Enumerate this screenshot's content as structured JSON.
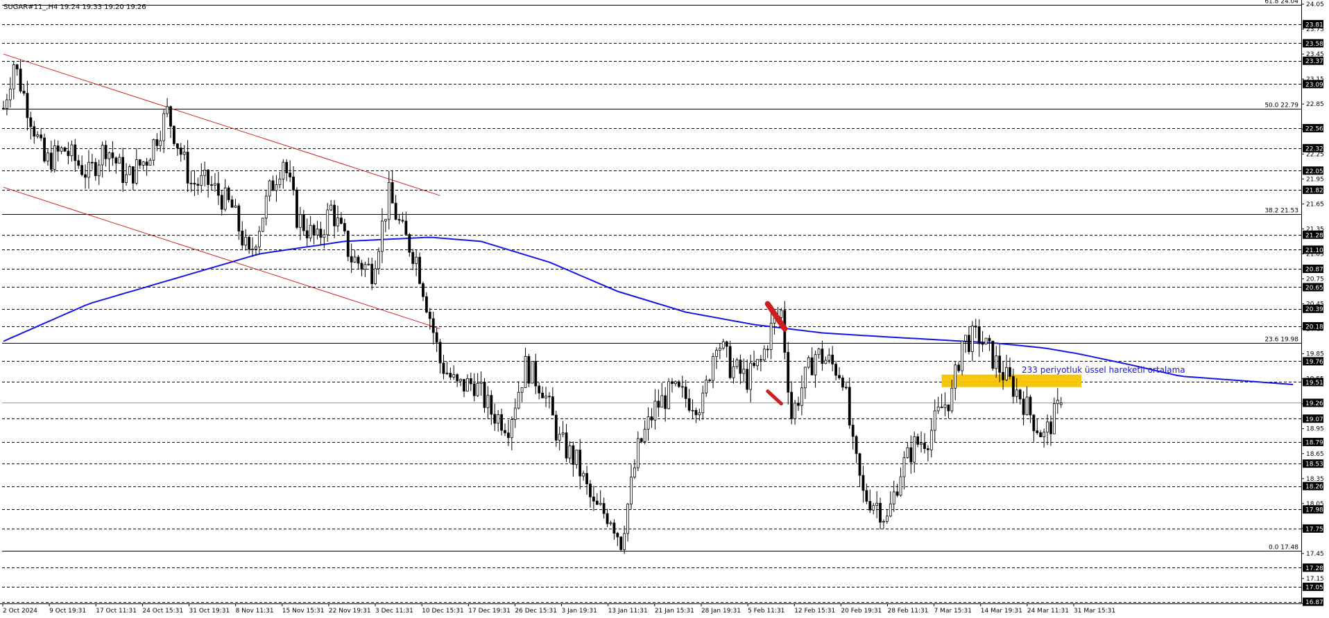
{
  "header": {
    "symbol_text": "SUGAR#11_,H4  19.24 19.33 19.20 19.26"
  },
  "colors": {
    "background": "#ffffff",
    "grid": "#000000",
    "candle_body": "#000000",
    "ema": "#1515e6",
    "channel": "#cc2222",
    "highlight": "#f5c400",
    "ema_label": "#1515e6",
    "marker": "#cc1f1f",
    "price_box_bg": "#000000",
    "price_box_fg": "#ffffff"
  },
  "chart_data": {
    "type": "candlestick",
    "symbol": "SUGAR#11",
    "timeframe": "H4",
    "last_bar": {
      "open": 19.24,
      "high": 19.33,
      "low": 19.2,
      "close": 19.26
    },
    "ylim": [
      16.87,
      24.04
    ],
    "x_tick_labels": [
      "2 Oct 2024",
      "9 Oct 19:31",
      "17 Oct 11:31",
      "24 Oct 15:31",
      "31 Oct 19:31",
      "8 Nov 11:31",
      "15 Nov 15:31",
      "22 Nov 19:31",
      "3 Dec 11:31",
      "10 Dec 15:31",
      "17 Dec 19:31",
      "26 Dec 15:31",
      "3 Jan 19:31",
      "13 Jan 11:31",
      "21 Jan 15:31",
      "28 Jan 19:31",
      "5 Feb 11:31",
      "12 Feb 15:31",
      "20 Feb 19:31",
      "28 Feb 11:31",
      "7 Mar 15:31",
      "14 Mar 19:31",
      "24 Mar 11:31",
      "31 Mar 15:31"
    ],
    "y_tick_labels": [
      {
        "value": 24.05,
        "text": "24.05"
      },
      {
        "value": 23.75,
        "text": "23.75"
      },
      {
        "value": 23.45,
        "text": "23.45"
      },
      {
        "value": 23.15,
        "text": "23.15"
      },
      {
        "value": 22.85,
        "text": "22.85"
      },
      {
        "value": 22.55,
        "text": "22.55"
      },
      {
        "value": 22.25,
        "text": "22.25"
      },
      {
        "value": 21.95,
        "text": "21.95"
      },
      {
        "value": 21.65,
        "text": "21.65"
      },
      {
        "value": 21.35,
        "text": "21.35"
      },
      {
        "value": 21.05,
        "text": "21.05"
      },
      {
        "value": 20.75,
        "text": "20.75"
      },
      {
        "value": 20.45,
        "text": "20.45"
      },
      {
        "value": 20.15,
        "text": "20.15"
      },
      {
        "value": 19.85,
        "text": "19.85"
      },
      {
        "value": 19.55,
        "text": "19.55"
      },
      {
        "value": 19.25,
        "text": "19.25"
      },
      {
        "value": 18.95,
        "text": "18.95"
      },
      {
        "value": 18.65,
        "text": "18.65"
      },
      {
        "value": 18.35,
        "text": "18.35"
      },
      {
        "value": 18.05,
        "text": "18.05"
      },
      {
        "value": 17.75,
        "text": "17.75"
      },
      {
        "value": 17.45,
        "text": "17.45"
      },
      {
        "value": 17.15,
        "text": "17.15"
      },
      {
        "value": 16.85,
        "text": "16.85"
      }
    ],
    "horizontal_levels": [
      {
        "value": 23.81,
        "text": "23.81"
      },
      {
        "value": 23.58,
        "text": "23.58"
      },
      {
        "value": 23.37,
        "text": "23.37"
      },
      {
        "value": 23.09,
        "text": "23.09"
      },
      {
        "value": 22.56,
        "text": "22.56"
      },
      {
        "value": 22.32,
        "text": "22.32"
      },
      {
        "value": 22.05,
        "text": "22.05"
      },
      {
        "value": 21.82,
        "text": "21.82"
      },
      {
        "value": 21.28,
        "text": "21.28"
      },
      {
        "value": 21.1,
        "text": "21.10"
      },
      {
        "value": 20.87,
        "text": "20.87"
      },
      {
        "value": 20.65,
        "text": "20.65"
      },
      {
        "value": 20.39,
        "text": "20.39"
      },
      {
        "value": 20.18,
        "text": "20.18"
      },
      {
        "value": 19.76,
        "text": "19.76"
      },
      {
        "value": 19.51,
        "text": "19.51"
      },
      {
        "value": 19.07,
        "text": "19.07"
      },
      {
        "value": 18.79,
        "text": "18.79"
      },
      {
        "value": 18.53,
        "text": "18.53"
      },
      {
        "value": 18.26,
        "text": "18.26"
      },
      {
        "value": 17.98,
        "text": "17.98"
      },
      {
        "value": 17.75,
        "text": "17.75"
      },
      {
        "value": 17.28,
        "text": "17.28"
      },
      {
        "value": 17.05,
        "text": "17.05"
      },
      {
        "value": 16.87,
        "text": "16.87"
      }
    ],
    "fibonacci_levels": [
      {
        "value": 24.04,
        "text": "61.8 24.04"
      },
      {
        "value": 22.79,
        "text": "50.0 22.79"
      },
      {
        "value": 21.53,
        "text": "38.2 21.53"
      },
      {
        "value": 19.98,
        "text": "23.6 19.98"
      },
      {
        "value": 17.48,
        "text": "0.0 17.48"
      }
    ],
    "current_price": {
      "value": 19.26,
      "text": "19.26"
    },
    "annotation": "233 periyotluk üssel hareketli ortalama",
    "ema_anchors": [
      [
        0,
        20.0
      ],
      [
        25,
        20.45
      ],
      [
        50,
        20.75
      ],
      [
        75,
        21.05
      ],
      [
        100,
        21.2
      ],
      [
        125,
        21.25
      ],
      [
        140,
        21.2
      ],
      [
        160,
        20.95
      ],
      [
        180,
        20.6
      ],
      [
        200,
        20.35
      ],
      [
        220,
        20.2
      ],
      [
        240,
        20.1
      ],
      [
        260,
        20.05
      ],
      [
        290,
        19.98
      ],
      [
        305,
        19.92
      ],
      [
        315,
        19.85
      ],
      [
        330,
        19.72
      ],
      [
        345,
        19.58
      ],
      [
        365,
        19.52
      ],
      [
        378,
        19.48
      ]
    ],
    "price_anchors": [
      [
        0,
        22.8
      ],
      [
        3,
        23.35
      ],
      [
        8,
        22.7
      ],
      [
        12,
        22.15
      ],
      [
        18,
        22.3
      ],
      [
        25,
        22.0
      ],
      [
        30,
        22.35
      ],
      [
        36,
        21.95
      ],
      [
        42,
        22.2
      ],
      [
        48,
        22.75
      ],
      [
        55,
        21.9
      ],
      [
        60,
        21.9
      ],
      [
        67,
        21.6
      ],
      [
        72,
        21.0
      ],
      [
        78,
        21.8
      ],
      [
        82,
        22.2
      ],
      [
        86,
        21.5
      ],
      [
        92,
        21.2
      ],
      [
        96,
        21.6
      ],
      [
        102,
        21.0
      ],
      [
        108,
        20.85
      ],
      [
        113,
        21.75
      ],
      [
        117,
        21.3
      ],
      [
        121,
        21.0
      ],
      [
        125,
        20.3
      ],
      [
        128,
        19.75
      ],
      [
        133,
        19.45
      ],
      [
        138,
        19.5
      ],
      [
        143,
        19.15
      ],
      [
        148,
        19.0
      ],
      [
        153,
        19.7
      ],
      [
        158,
        19.45
      ],
      [
        163,
        18.8
      ],
      [
        168,
        18.55
      ],
      [
        173,
        18.0
      ],
      [
        178,
        17.9
      ],
      [
        181,
        17.6
      ],
      [
        186,
        18.7
      ],
      [
        191,
        19.2
      ],
      [
        196,
        19.4
      ],
      [
        201,
        19.3
      ],
      [
        205,
        19.25
      ],
      [
        209,
        20.05
      ],
      [
        213,
        19.7
      ],
      [
        218,
        19.55
      ],
      [
        222,
        19.75
      ],
      [
        225,
        20.15
      ],
      [
        228,
        20.35
      ],
      [
        231,
        19.1
      ],
      [
        234,
        19.45
      ],
      [
        238,
        19.85
      ],
      [
        242,
        19.75
      ],
      [
        246,
        19.6
      ],
      [
        249,
        18.7
      ],
      [
        252,
        18.15
      ],
      [
        256,
        18.05
      ],
      [
        259,
        17.85
      ],
      [
        263,
        18.45
      ],
      [
        267,
        18.75
      ],
      [
        271,
        18.85
      ],
      [
        275,
        19.2
      ],
      [
        278,
        19.35
      ],
      [
        281,
        20.0
      ],
      [
        286,
        20.05
      ],
      [
        290,
        19.8
      ],
      [
        294,
        19.55
      ],
      [
        298,
        19.35
      ],
      [
        302,
        19.05
      ],
      [
        305,
        18.85
      ],
      [
        310,
        19.26
      ]
    ],
    "channel_lines": [
      {
        "from": [
          0,
          23.45
        ],
        "to": [
          128,
          21.75
        ]
      },
      {
        "from": [
          0,
          21.85
        ],
        "to": [
          128,
          20.15
        ]
      }
    ],
    "highlight_zone": {
      "x_from": 275,
      "x_to": 316,
      "y_from": 19.45,
      "y_to": 19.6
    }
  }
}
